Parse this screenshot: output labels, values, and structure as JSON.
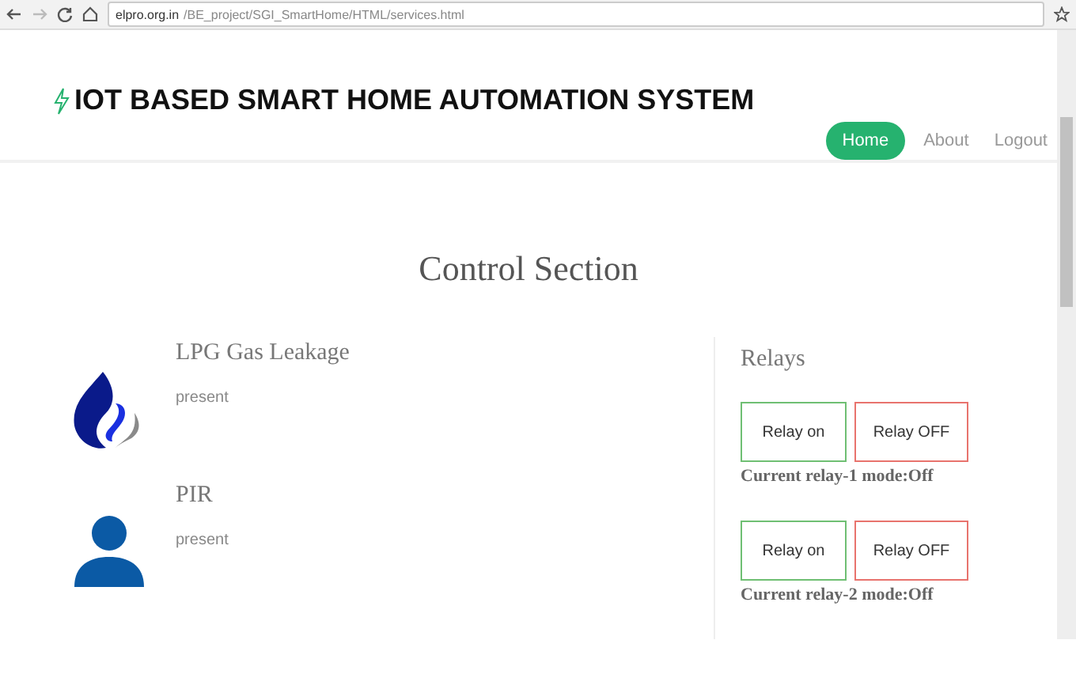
{
  "browser": {
    "url_host": "elpro.org.in",
    "url_path": "/BE_project/SGI_SmartHome/HTML/services.html"
  },
  "header": {
    "title": "IOT BASED SMART HOME AUTOMATION SYSTEM",
    "nav": [
      {
        "label": "Home",
        "selected": true
      },
      {
        "label": "About",
        "selected": false
      },
      {
        "label": "Logout",
        "selected": false
      }
    ]
  },
  "section_title": "Control Section",
  "sensors": [
    {
      "kind": "gas",
      "name": "LPG Gas Leakage",
      "status": "present"
    },
    {
      "kind": "person",
      "name": "PIR",
      "status": "present"
    }
  ],
  "relays": {
    "title": "Relays",
    "groups": [
      {
        "buttons": [
          {
            "kind": "on",
            "label": "Relay on"
          },
          {
            "kind": "off",
            "label": "Relay OFF"
          }
        ],
        "mode": "Current relay-1 mode:Off"
      },
      {
        "buttons": [
          {
            "kind": "on",
            "label": "Relay on"
          },
          {
            "kind": "off",
            "label": "Relay OFF"
          }
        ],
        "mode": "Current relay-2 mode:Off"
      }
    ]
  }
}
